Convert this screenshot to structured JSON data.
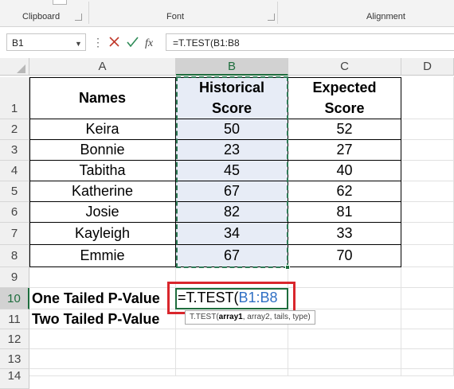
{
  "ribbon": {
    "groups": [
      {
        "label": "Clipboard"
      },
      {
        "label": "Font"
      },
      {
        "label": "Alignment"
      }
    ]
  },
  "formula_bar": {
    "name_box": "B1",
    "formula": "=T.TEST(B1:B8",
    "icons": [
      "cancel-icon",
      "enter-icon",
      "fx-icon"
    ]
  },
  "grid": {
    "columns": [
      "A",
      "B",
      "C",
      "D"
    ],
    "rows": [
      "1",
      "2",
      "3",
      "4",
      "5",
      "6",
      "7",
      "8",
      "9",
      "10",
      "11",
      "12",
      "13",
      "14"
    ],
    "selected_column": "B",
    "selected_row": "10",
    "headers": {
      "names": "Names",
      "historical_line1": "Historical",
      "historical_line2": "Score",
      "expected_line1": "Expected",
      "expected_line2": "Score"
    },
    "data": [
      {
        "name": "Keira",
        "historical": "50",
        "expected": "52"
      },
      {
        "name": "Bonnie",
        "historical": "23",
        "expected": "27"
      },
      {
        "name": "Tabitha",
        "historical": "45",
        "expected": "40"
      },
      {
        "name": "Katherine",
        "historical": "67",
        "expected": "62"
      },
      {
        "name": "Josie",
        "historical": "82",
        "expected": "81"
      },
      {
        "name": "Kayleigh",
        "historical": "34",
        "expected": "33"
      },
      {
        "name": "Emmie",
        "historical": "67",
        "expected": "70"
      }
    ],
    "label_one_tailed": "One Tailed P-Value",
    "label_two_tailed": "Two Tailed P-Value",
    "edit_prefix": "=T.TEST(",
    "edit_ref": "B1:B8",
    "tooltip": {
      "func": "T.TEST(",
      "arg1": "array1",
      "rest": ", array2, tails, type)"
    }
  },
  "colors": {
    "accent_green": "#1e6d3d",
    "highlight_red": "#d9262c",
    "reference_blue": "#2f6fc4",
    "selection_fill": "#e7ecf6"
  }
}
